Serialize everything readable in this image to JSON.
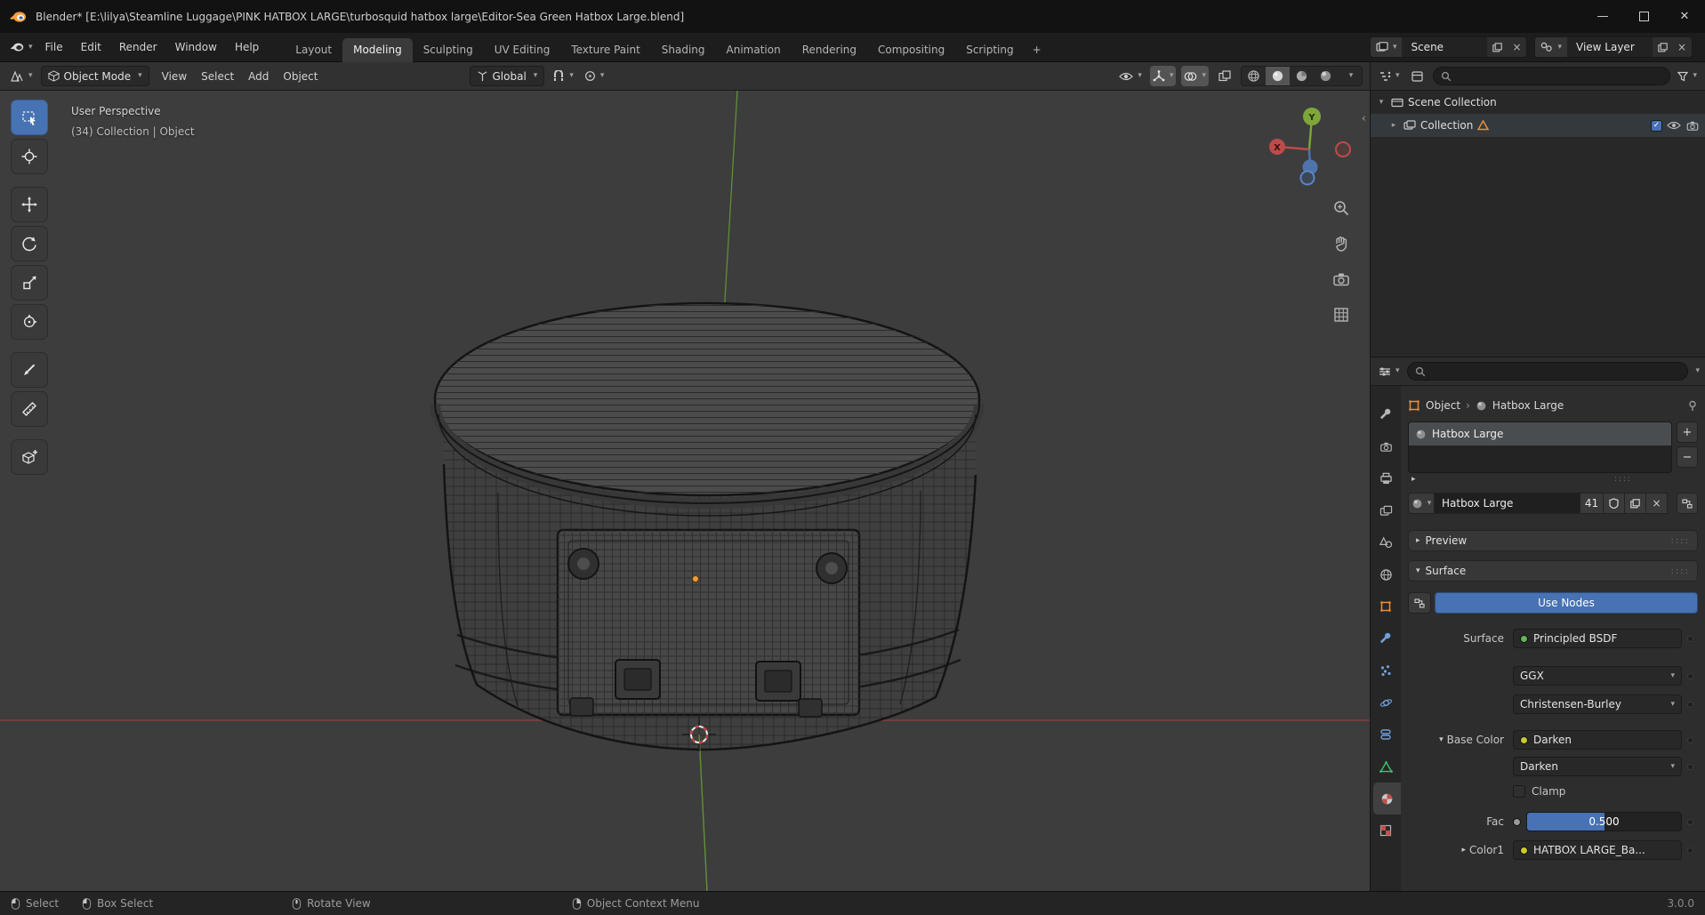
{
  "window": {
    "title": "Blender* [E:\\lilya\\Steamline Luggage\\PINK HATBOX LARGE\\turbosquid hatbox large\\Editor-Sea Green Hatbox Large.blend]"
  },
  "topbar": {
    "menus": [
      "File",
      "Edit",
      "Render",
      "Window",
      "Help"
    ],
    "workspaces": [
      "Layout",
      "Modeling",
      "Sculpting",
      "UV Editing",
      "Texture Paint",
      "Shading",
      "Animation",
      "Rendering",
      "Compositing",
      "Scripting"
    ],
    "add_workspace": "+",
    "scene_field": "Scene",
    "view_layer_field": "View Layer"
  },
  "viewport_header": {
    "mode": "Object Mode",
    "menus": [
      "View",
      "Select",
      "Add",
      "Object"
    ],
    "orientation": "Global"
  },
  "viewport": {
    "view_label": "User Perspective",
    "context_label": "(34) Collection | Object",
    "axis_y": "Y",
    "axis_x": "X"
  },
  "outliner": {
    "scene_collection": "Scene Collection",
    "collection": "Collection"
  },
  "properties": {
    "breadcrumb": {
      "root": "Object",
      "item": "Hatbox Large"
    },
    "slot_active": "Hatbox Large",
    "slot_add": "+",
    "slot_remove": "−",
    "datablock": {
      "name": "Hatbox Large",
      "users": "41"
    },
    "preview_panel": "Preview",
    "surface_panel": "Surface",
    "use_nodes": "Use Nodes",
    "surface_label": "Surface",
    "surface_value": "Principled BSDF",
    "distribution": "GGX",
    "subsurface_method": "Christensen-Burley",
    "base_color_label": "Base Color",
    "base_color_value": "Darken",
    "blend_mode": "Darken",
    "clamp_label": "Clamp",
    "fac_label": "Fac",
    "fac_value": "0.500",
    "color1_label": "Color1",
    "color1_value": "HATBOX LARGE_Ba..."
  },
  "statusbar": {
    "hints": [
      "Select",
      "Box Select",
      "Rotate View",
      "Object Context Menu"
    ],
    "version": "3.0.0"
  }
}
